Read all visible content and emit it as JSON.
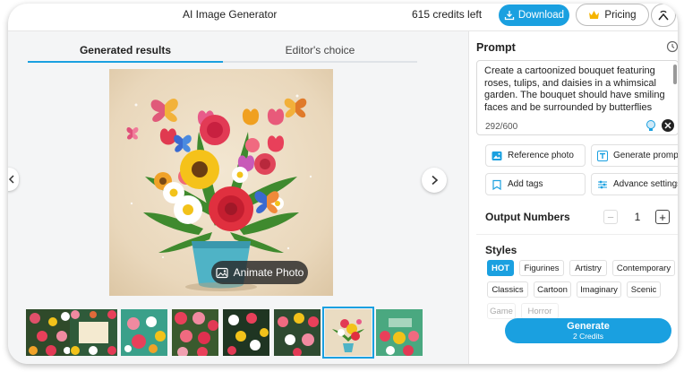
{
  "header": {
    "title": "AI Image Generator",
    "credits": "615 credits left",
    "download_label": "Download",
    "pricing_label": "Pricing"
  },
  "tabs": [
    {
      "label": "Generated results",
      "active": true
    },
    {
      "label": "Editor's choice",
      "active": false
    }
  ],
  "preview": {
    "animate_label": "Animate Photo",
    "selected_thumbnail": 6,
    "thumbnail_count": 8
  },
  "prompt": {
    "label": "Prompt",
    "text": "Create a cartoonized bouquet featuring roses, tulips, and daisies in a whimsical garden. The bouquet should have smiling faces and be surrounded by butterflies",
    "count": "292/600"
  },
  "options": {
    "reference_photo": "Reference photo",
    "generate_prompt": "Generate prompt",
    "add_tags": "Add tags",
    "advance_settings": "Advance settings"
  },
  "output_numbers": {
    "label": "Output Numbers",
    "value": "1",
    "minus": "−",
    "plus": "+"
  },
  "styles": {
    "label": "Styles",
    "items": [
      "HOT",
      "Figurines",
      "Artistry",
      "Contemporary",
      "Classics",
      "Cartoon",
      "Imaginary",
      "Scenic",
      "Game",
      "Horror"
    ],
    "active": "HOT"
  },
  "generate": {
    "label": "Generate",
    "sub": "2 Credits"
  },
  "colors": {
    "accent": "#1aa0e0",
    "panel_bg": "#f4f5f6"
  }
}
